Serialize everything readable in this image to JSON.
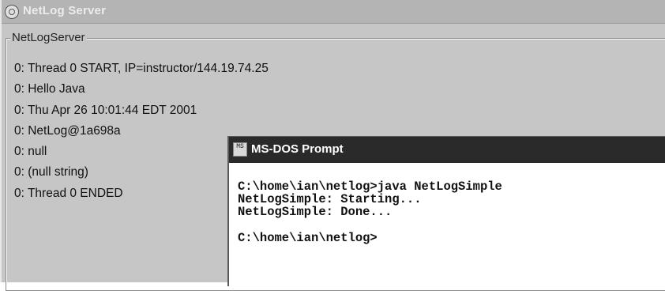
{
  "netlog_window": {
    "title": "NetLog Server",
    "group_label": "NetLogServer",
    "log_lines": [
      "0: Thread 0 START, IP=instructor/144.19.74.25",
      "0: Hello Java",
      "0: Thu Apr 26 10:01:44 EDT 2001",
      "0: NetLog@1a698a",
      "0: null",
      "0: (null string)",
      "0: Thread 0 ENDED"
    ]
  },
  "dos_window": {
    "title": "MS-DOS Prompt",
    "icon_text": "MS",
    "console_lines": [
      "C:\\home\\ian\\netlog>java NetLogSimple",
      "NetLogSimple: Starting...",
      "NetLogSimple: Done...",
      "",
      "C:\\home\\ian\\netlog>"
    ]
  }
}
